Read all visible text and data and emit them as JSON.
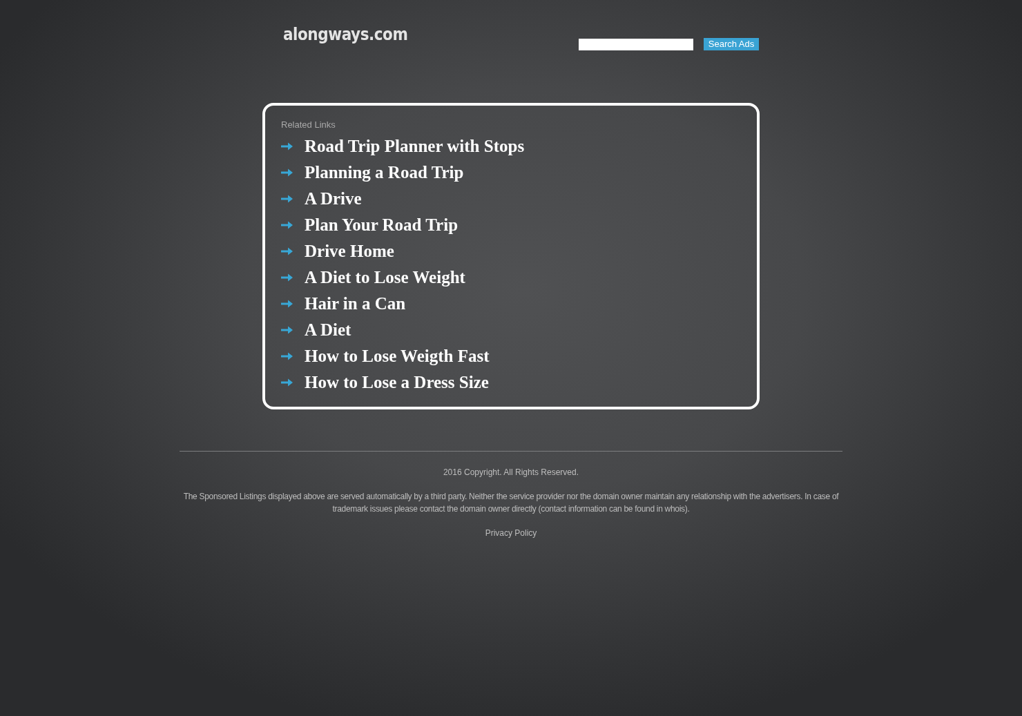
{
  "header": {
    "logo": "alongways.com",
    "search_button": "Search Ads"
  },
  "related_links": {
    "title": "Related Links",
    "items": [
      "Road Trip Planner with Stops",
      "Planning a Road Trip",
      "A Drive",
      "Plan Your Road Trip",
      "Drive Home",
      "A Diet to Lose Weight",
      "Hair in a Can",
      "A Diet",
      "How to Lose Weigth Fast",
      "How to Lose a Dress Size"
    ]
  },
  "footer": {
    "copyright": "2016 Copyright. All Rights Reserved.",
    "disclaimer": "The Sponsored Listings displayed above are served automatically by a third party. Neither the service provider nor the domain owner maintain any relationship with the advertisers. In case of trademark issues please contact the domain owner directly (contact information can be found in whois).",
    "privacy_policy": "Privacy Policy"
  }
}
